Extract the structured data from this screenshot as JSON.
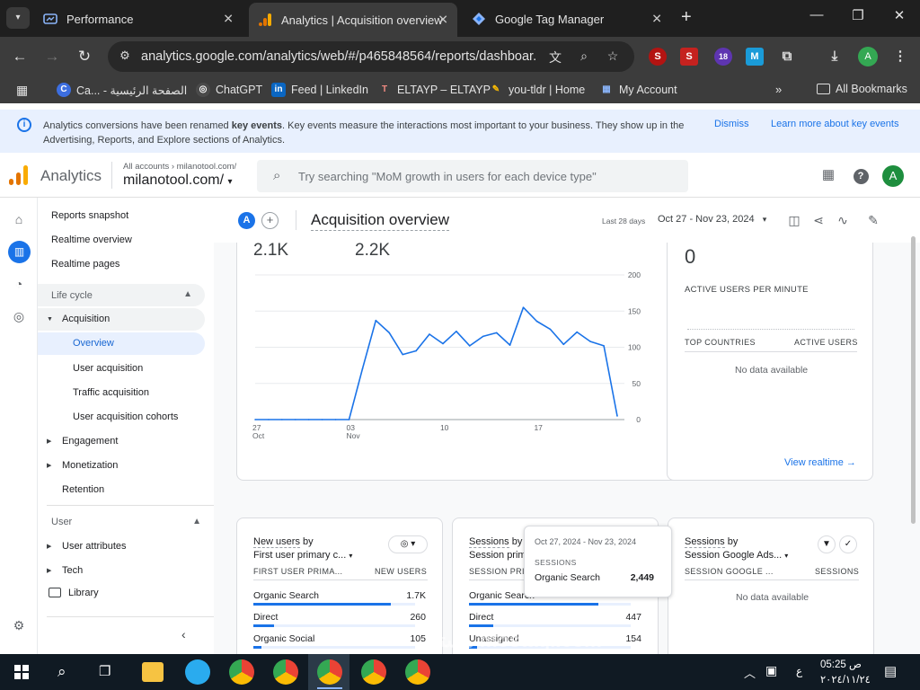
{
  "browser": {
    "tabs": [
      {
        "title": "Performance",
        "active": false
      },
      {
        "title": "Analytics | Acquisition overview",
        "active": true
      },
      {
        "title": "Google Tag Manager",
        "active": false
      }
    ],
    "url": "analytics.google.com/analytics/web/#/p465848564/reports/dashboar...",
    "bookmarks": [
      {
        "label": "Ca... - الصفحة الرئيسية",
        "icon": "c-icon"
      },
      {
        "label": "ChatGPT",
        "icon": "chatgpt-icon"
      },
      {
        "label": "Feed | LinkedIn",
        "icon": "linkedin-icon"
      },
      {
        "label": "ELTAYP – ELTAYP",
        "icon": "eltayp-icon"
      },
      {
        "label": "you-tldr | Home",
        "icon": "you-tldr-icon"
      },
      {
        "label": "My Account",
        "icon": "grid-icon"
      }
    ],
    "all_bookmarks": "All Bookmarks",
    "extension_badge": "18",
    "profile_initial": "A"
  },
  "notice": {
    "text_before": "Analytics conversions have been renamed ",
    "text_bold": "key events",
    "text_after": ". Key events measure the interactions most important to your business. They show up in the Advertising, Reports, and Explore sections of Analytics.",
    "dismiss": "Dismiss",
    "learn_more": "Learn more about key events"
  },
  "header": {
    "product": "Analytics",
    "breadcrumb": "All accounts › milanotool.com/",
    "account": "milanotool.com/",
    "search_placeholder": "Try searching \"MoM growth in users for each device type\"",
    "avatar": "A"
  },
  "sidebar": {
    "top_items": [
      "Reports snapshot",
      "Realtime overview",
      "Realtime pages"
    ],
    "lifecycle": "Life cycle",
    "acquisition": "Acquisition",
    "acquisition_children": [
      "Overview",
      "User acquisition",
      "Traffic acquisition",
      "User acquisition cohorts"
    ],
    "engagement": "Engagement",
    "monetization": "Monetization",
    "retention": "Retention",
    "user_section": "User",
    "user_attributes": "User attributes",
    "tech": "Tech",
    "library": "Library"
  },
  "page": {
    "property_chip": "A",
    "title": "Acquisition overview",
    "date_label": "Last 28 days",
    "date_range": "Oct 27 - Nov 23, 2024"
  },
  "overview_card": {
    "metric_a": "2.1K",
    "metric_b": "2.2K"
  },
  "chart_data": {
    "type": "line",
    "x": [
      "2024-10-27",
      "2024-10-28",
      "2024-10-29",
      "2024-10-30",
      "2024-10-31",
      "2024-11-01",
      "2024-11-02",
      "2024-11-03",
      "2024-11-04",
      "2024-11-05",
      "2024-11-06",
      "2024-11-07",
      "2024-11-08",
      "2024-11-09",
      "2024-11-10",
      "2024-11-11",
      "2024-11-12",
      "2024-11-13",
      "2024-11-14",
      "2024-11-15",
      "2024-11-16",
      "2024-11-17",
      "2024-11-18",
      "2024-11-19",
      "2024-11-20",
      "2024-11-21",
      "2024-11-22",
      "2024-11-23"
    ],
    "values": [
      0,
      0,
      0,
      0,
      0,
      0,
      0,
      0,
      70,
      137,
      120,
      90,
      95,
      118,
      105,
      122,
      102,
      115,
      120,
      103,
      155,
      136,
      125,
      104,
      121,
      108,
      102,
      5
    ],
    "y_ticks": [
      0,
      50,
      100,
      150,
      200
    ],
    "x_tick_labels": [
      {
        "day": "27",
        "month": "Oct",
        "index": 0
      },
      {
        "day": "03",
        "month": "Nov",
        "index": 7
      },
      {
        "day": "10",
        "month": "",
        "index": 14
      },
      {
        "day": "17",
        "month": "",
        "index": 21
      }
    ],
    "ylim": [
      0,
      200
    ],
    "line_color": "#1a73e8",
    "grid": true
  },
  "realtime_card": {
    "value": "0",
    "label": "ACTIVE USERS PER MINUTE",
    "col_a": "TOP COUNTRIES",
    "col_b": "ACTIVE USERS",
    "nodata": "No data available",
    "link": "View realtime"
  },
  "new_users_card": {
    "title_prefix": "New users",
    "title_suffix": " by",
    "dimension": "First user primary c...",
    "col_a": "FIRST USER PRIMA...",
    "col_b": "NEW USERS",
    "rows": [
      {
        "label": "Organic Search",
        "value": "1.7K",
        "fraction": 0.85
      },
      {
        "label": "Direct",
        "value": "260",
        "fraction": 0.13
      },
      {
        "label": "Organic Social",
        "value": "105",
        "fraction": 0.05
      }
    ]
  },
  "sessions_card": {
    "title_prefix": "Sessions",
    "title_suffix": " by",
    "dimension": "Session primar",
    "col_a": "SESSION PRI",
    "rows": [
      {
        "label": "Organic Search",
        "value": "",
        "fraction": 0.8
      },
      {
        "label": "Direct",
        "value": "447",
        "fraction": 0.15
      },
      {
        "label": "Unassigned",
        "value": "154",
        "fraction": 0.05
      }
    ]
  },
  "tooltip": {
    "date": "Oct 27, 2024 - Nov 23, 2024",
    "metric": "SESSIONS",
    "row_label": "Organic Search",
    "row_value": "2,449"
  },
  "ads_card": {
    "title_prefix": "Sessions",
    "title_suffix": " by",
    "dimension": "Session Google Ads...",
    "col_a": "SESSION GOOGLE ...",
    "col_b": "SESSIONS",
    "nodata": "No data available"
  },
  "taskbar": {
    "time": "05:25 ص",
    "date": "٢٠٢٤/١١/٢٤",
    "lang": "ع",
    "watermark": "مستقل mostaql.com"
  }
}
